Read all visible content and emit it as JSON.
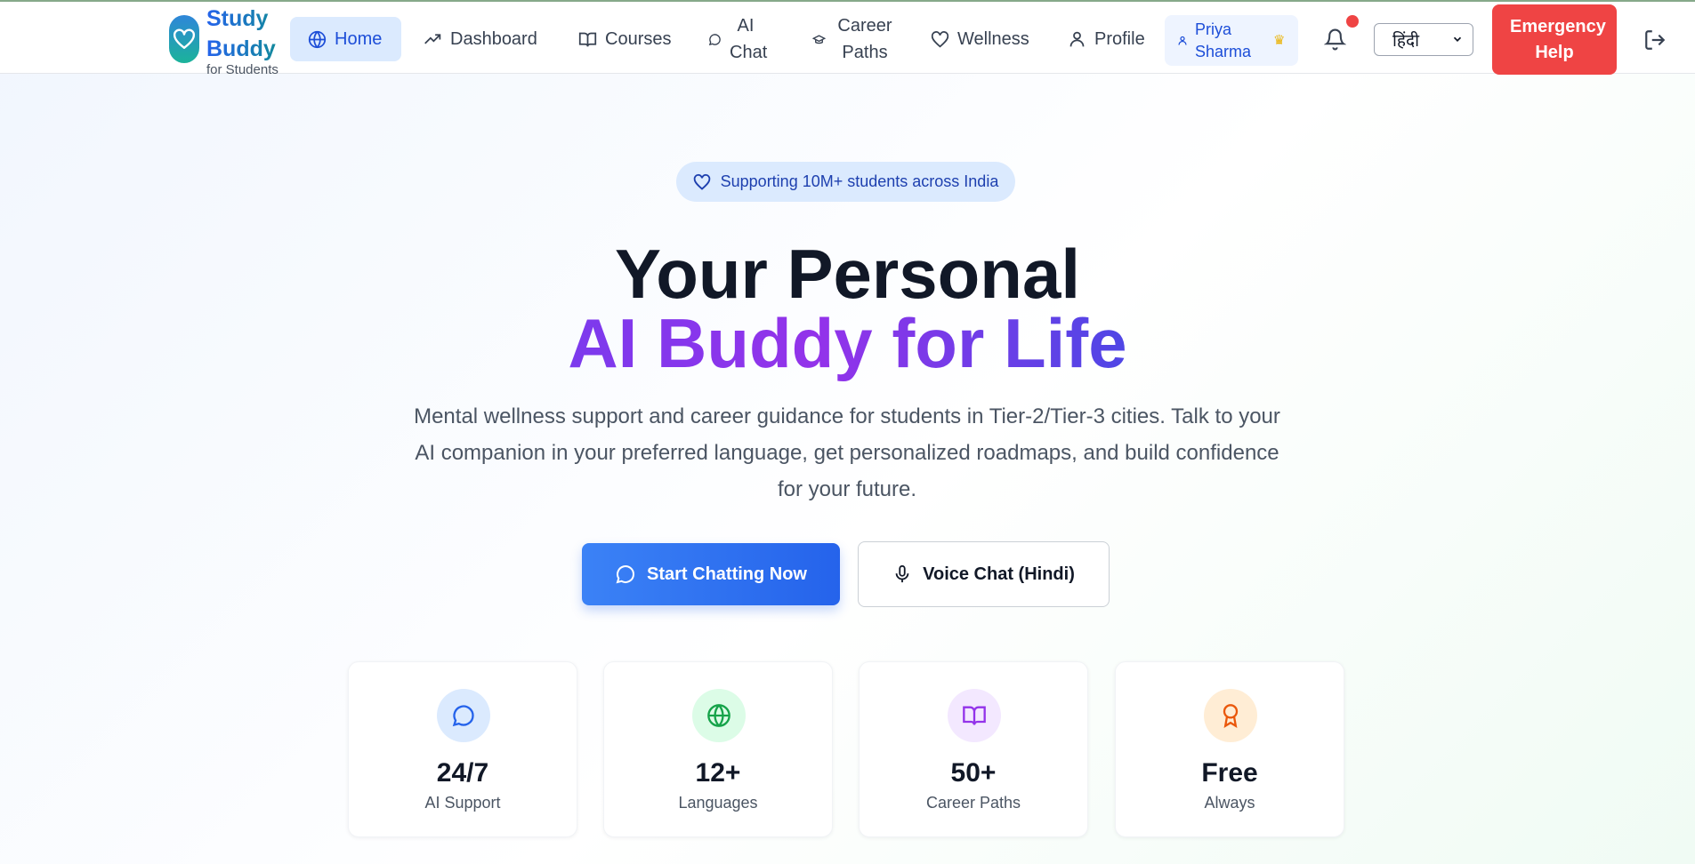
{
  "brand": {
    "name": "Study Buddy",
    "tagline": "for Students"
  },
  "nav": {
    "items": [
      {
        "label": "Home",
        "icon": "globe-icon",
        "active": true
      },
      {
        "label": "Dashboard",
        "icon": "trend-up-icon"
      },
      {
        "label": "Courses",
        "icon": "book-open-icon"
      },
      {
        "label": "AI Chat",
        "icon": "chat-icon"
      },
      {
        "label": "Career Paths",
        "icon": "graduation-cap-icon"
      },
      {
        "label": "Wellness",
        "icon": "heart-icon"
      },
      {
        "label": "Profile",
        "icon": "user-icon"
      }
    ],
    "user": {
      "name": "Priya Sharma",
      "badge_icon": "crown-icon"
    },
    "language": {
      "selected": "हिंदी"
    },
    "emergency_label": "Emergency Help"
  },
  "hero": {
    "badge": "Supporting 10M+ students across India",
    "title_line1": "Your Personal",
    "title_line2": "AI Buddy for Life",
    "description": "Mental wellness support and career guidance for students in Tier-2/Tier-3 cities. Talk to your AI companion in your preferred language, get personalized roadmaps, and build confidence for your future.",
    "primary_cta": "Start Chatting Now",
    "secondary_cta": "Voice Chat (Hindi)"
  },
  "stats": [
    {
      "value": "24/7",
      "label": "AI Support",
      "icon": "chat-icon",
      "color": "#2563eb"
    },
    {
      "value": "12+",
      "label": "Languages",
      "icon": "globe-icon",
      "color": "#16a34a"
    },
    {
      "value": "50+",
      "label": "Career Paths",
      "icon": "book-open-icon",
      "color": "#9333ea"
    },
    {
      "value": "Free",
      "label": "Always",
      "icon": "award-icon",
      "color": "#ea580c"
    }
  ],
  "colors": {
    "primary": "#2563eb",
    "emergency": "#ef4444",
    "accent_purple": "#7c3aed",
    "active_nav_bg": "#dbeafe"
  }
}
